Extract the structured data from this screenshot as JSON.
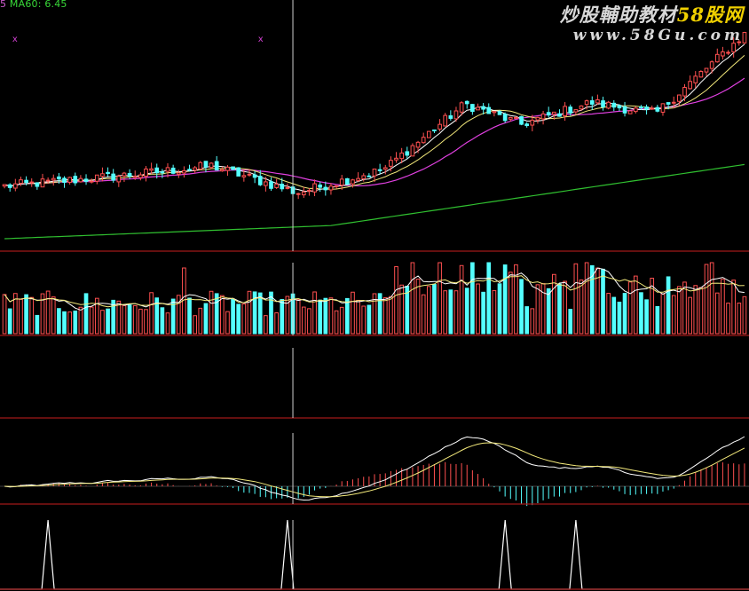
{
  "header": {
    "prefix": "5",
    "ma_label": "MA60: 6.45"
  },
  "watermark": {
    "site_name": "炒股輔助教材",
    "site_brand": "58股网",
    "url": "www.58Gu.com"
  },
  "colors": {
    "background": "#000000",
    "up": "#ff5050",
    "down": "#54ffff",
    "ma_white": "#ffffff",
    "ma_yellow": "#f2e87a",
    "ma_magenta": "#e040e0",
    "ma_green": "#30c030",
    "separator": "#a01818",
    "crosshair": "#d0d0d0",
    "signal": "#ffffff",
    "marker": "#d040d0"
  },
  "chart_data": [
    {
      "type": "candlestick",
      "panel": "price",
      "title": "",
      "series": [
        {
          "name": "candles",
          "count": 137,
          "trend": "flat then rising"
        },
        {
          "name": "MA60",
          "color": "green"
        },
        {
          "name": "MA5",
          "color": "white"
        },
        {
          "name": "MA10",
          "color": "yellow"
        },
        {
          "name": "MA20",
          "color": "magenta"
        }
      ],
      "markers": [
        "x",
        "x"
      ],
      "crosshair_index": 53
    },
    {
      "type": "bar",
      "panel": "volume",
      "series": [
        {
          "count": 137
        }
      ],
      "moving_averages": [
        "white",
        "yellow"
      ]
    },
    {
      "type": "line",
      "panel": "empty indicator",
      "series": []
    },
    {
      "type": "bar",
      "panel": "macd",
      "series": [
        {
          "name": "histogram"
        }
      ],
      "moving_averages": [
        "white",
        "yellow"
      ]
    },
    {
      "type": "line",
      "panel": "signal",
      "spike_indices": [
        8,
        52,
        92,
        105
      ]
    }
  ]
}
